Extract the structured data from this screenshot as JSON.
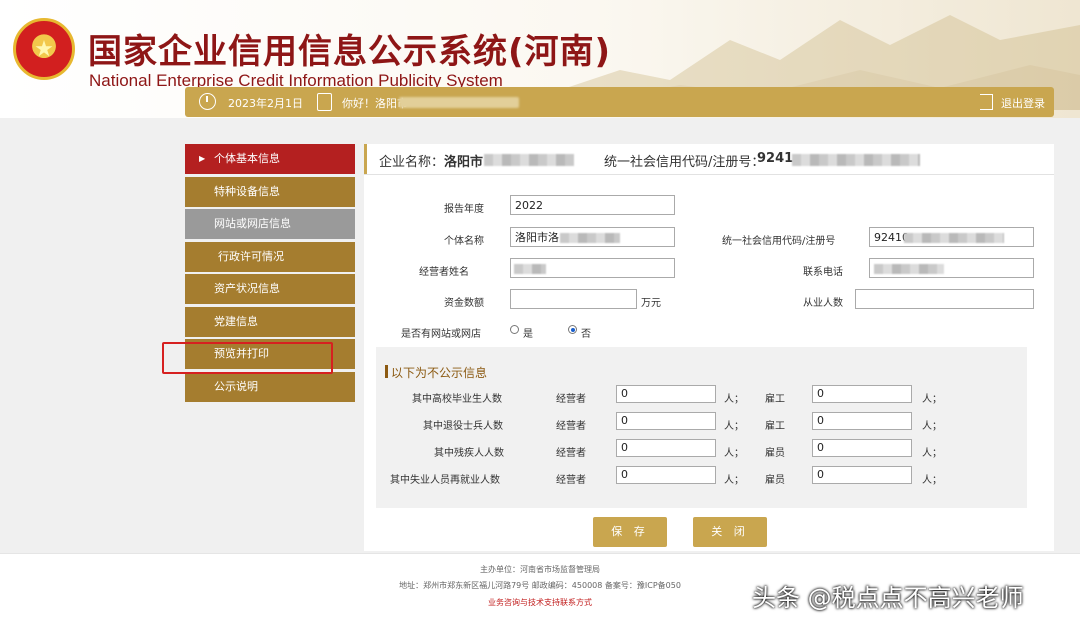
{
  "header": {
    "title_cn": "国家企业信用信息公示系统(河南)",
    "title_en": "National Enterprise Credit Information Publicity System"
  },
  "userbar": {
    "date": "2023年2月1日",
    "greeting": "你好！洛阳市",
    "logout": "退出登录"
  },
  "sidenav": {
    "items": [
      {
        "label": "个体基本信息"
      },
      {
        "label": "特种设备信息"
      },
      {
        "label": "网站或网店信息"
      },
      {
        "label": "行政许可情况"
      },
      {
        "label": "资产状况信息"
      },
      {
        "label": "党建信息"
      },
      {
        "label": "预览并打印"
      },
      {
        "label": "公示说明"
      }
    ]
  },
  "summary": {
    "company_label": "企业名称：",
    "company_value": "洛阳市",
    "code_label": "统一社会信用代码/注册号：",
    "code_value": "9241"
  },
  "form": {
    "year_label": "报告年度",
    "year_value": "2022",
    "name_label": "个体名称",
    "name_value": "洛阳市洛",
    "code_label": "统一社会信用代码/注册号",
    "code_value": "92410",
    "operator_label": "经营者姓名",
    "phone_label": "联系电话",
    "capital_label": "资金数额",
    "capital_unit": "万元",
    "employees_label": "从业人数",
    "website_label": "是否有网站或网店",
    "yes": "是",
    "no": "否",
    "website_selected": "否"
  },
  "nonpublic": {
    "title": "以下为不公示信息",
    "rows": [
      {
        "label": "其中高校毕业生人数",
        "c1": "经营者",
        "v1": "0",
        "u1": "人；",
        "c2": "雇工",
        "v2": "0",
        "u2": "人；"
      },
      {
        "label": "其中退役士兵人数",
        "c1": "经营者",
        "v1": "0",
        "u1": "人；",
        "c2": "雇工",
        "v2": "0",
        "u2": "人；"
      },
      {
        "label": "其中残疾人人数",
        "c1": "经营者",
        "v1": "0",
        "u1": "人；",
        "c2": "雇员",
        "v2": "0",
        "u2": "人；"
      },
      {
        "label": "其中失业人员再就业人数",
        "c1": "经营者",
        "v1": "0",
        "u1": "人；",
        "c2": "雇员",
        "v2": "0",
        "u2": "人；"
      }
    ]
  },
  "buttons": {
    "save": "保 存",
    "close": "关 闭"
  },
  "footer": {
    "line1": "主办单位：河南省市场监督管理局",
    "line2": "地址：郑州市郑东新区福儿河路79号 邮政编码：450008 备案号：豫ICP备050",
    "line3": "业务咨询与技术支持联系方式"
  },
  "watermark": "头条 @税点点不高兴老师",
  "colors": {
    "brand_red": "#b42020",
    "gold": "#c9a64f",
    "nav_brown": "#a57d2f"
  }
}
